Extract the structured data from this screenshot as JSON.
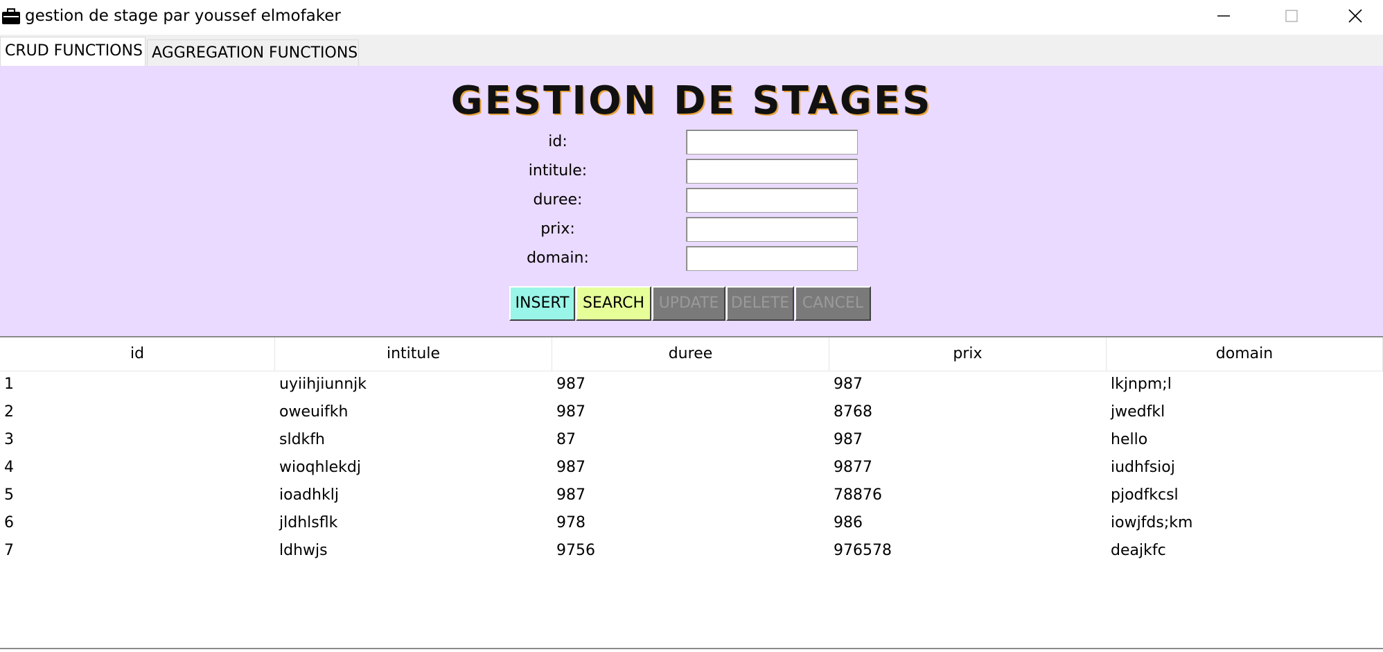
{
  "window": {
    "title": "gestion de stage par youssef elmofaker",
    "icon": "briefcase-icon"
  },
  "tabs": [
    {
      "label": "CRUD FUNCTIONS",
      "selected": true
    },
    {
      "label": "AGGREGATION FUNCTIONS",
      "selected": false
    }
  ],
  "form": {
    "heading": "GESTION DE STAGES",
    "fields": [
      {
        "label": "id:",
        "value": ""
      },
      {
        "label": "intitule:",
        "value": ""
      },
      {
        "label": "duree:",
        "value": ""
      },
      {
        "label": "prix:",
        "value": ""
      },
      {
        "label": "domain:",
        "value": ""
      }
    ],
    "buttons": {
      "insert": "INSERT",
      "search": "SEARCH",
      "update": "UPDATE",
      "delete": "DELETE",
      "cancel": "CANCEL"
    },
    "colors": {
      "panel": "#eadaff",
      "insert": "#99f5e7",
      "search": "#e6ff99",
      "disabled": "#7a7a7a"
    }
  },
  "table": {
    "columns": [
      "id",
      "intitule",
      "duree",
      "prix",
      "domain"
    ],
    "rows": [
      [
        "1",
        "uyiihjiunnjk",
        "987",
        "987",
        "lkjnpm;l"
      ],
      [
        "2",
        "oweuifkh",
        "987",
        "8768",
        "jwedfkl"
      ],
      [
        "3",
        "sldkfh",
        "87",
        "987",
        "hello"
      ],
      [
        "4",
        "wioqhlekdj",
        "987",
        "9877",
        "iudhfsioj"
      ],
      [
        "5",
        "ioadhklj",
        "987",
        "78876",
        "pjodfkcsl"
      ],
      [
        "6",
        "jldhlsflk",
        "978",
        "986",
        "iowjfds;km"
      ],
      [
        "7",
        "ldhwjs",
        "9756",
        "976578",
        "deajkfc"
      ]
    ]
  }
}
